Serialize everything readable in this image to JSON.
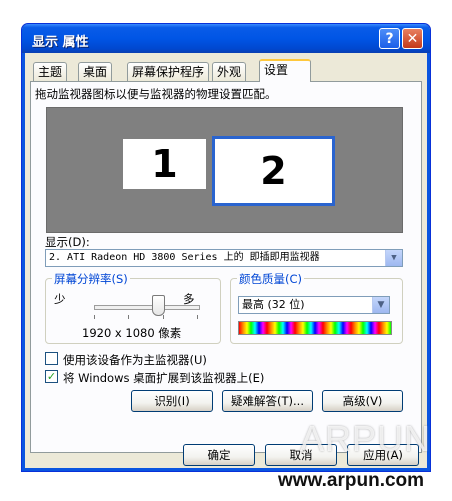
{
  "window": {
    "title": "显示 属性",
    "help": "?",
    "close": "✕"
  },
  "tabs": [
    {
      "label": "主题"
    },
    {
      "label": "桌面"
    },
    {
      "label": "屏幕保护程序"
    },
    {
      "label": "外观"
    },
    {
      "label": "设置"
    }
  ],
  "active_tab": "设置",
  "settings": {
    "instruction": "拖动监视器图标以便与监视器的物理设置匹配。",
    "monitors": [
      {
        "number": "1"
      },
      {
        "number": "2"
      }
    ],
    "display_label": "显示(D):",
    "display_value": "2. ATI Radeon HD 3800 Series 上的 即插即用监视器",
    "resolution": {
      "title": "屏幕分辨率(S)",
      "less": "少",
      "more": "多",
      "value": "1920 x 1080 像素",
      "slider_fraction": 0.6
    },
    "color_quality": {
      "title": "颜色质量(C)",
      "value": "最高 (32 位)"
    },
    "primary_checkbox": {
      "label": "使用该设备作为主监视器(U)",
      "checked": false
    },
    "extend_checkbox": {
      "label": "将 Windows 桌面扩展到该监视器上(E)",
      "checked": true
    },
    "buttons": {
      "identify": "识别(I)",
      "troubleshoot": "疑难解答(T)...",
      "advanced": "高级(V)"
    }
  },
  "footer_buttons": {
    "ok": "确定",
    "cancel": "取消",
    "apply": "应用(A)"
  },
  "watermark": "ARPUN",
  "website": "www.arpun.com"
}
